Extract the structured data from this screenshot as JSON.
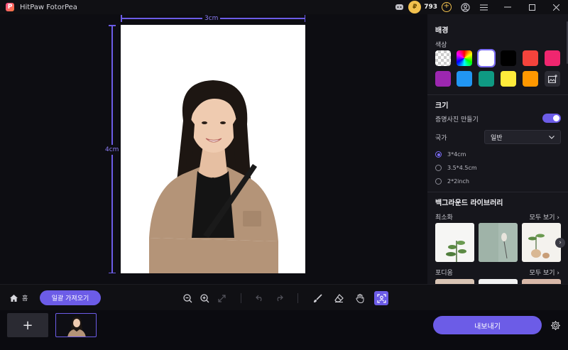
{
  "app": {
    "title": "HitPaw FotorPea",
    "coins": "793"
  },
  "canvas": {
    "width_label": "3cm",
    "height_label": "4cm"
  },
  "panel": {
    "background_title": "배경",
    "color_label": "색상",
    "swatches": [
      {
        "name": "transparent",
        "color": "transparent"
      },
      {
        "name": "rainbow",
        "color": "gradient"
      },
      {
        "name": "white",
        "color": "#ffffff"
      },
      {
        "name": "black",
        "color": "#000000"
      },
      {
        "name": "red",
        "color": "#f4433c"
      },
      {
        "name": "pink",
        "color": "#f0266f"
      },
      {
        "name": "purple",
        "color": "#9c27b0"
      },
      {
        "name": "blue",
        "color": "#2196f3"
      },
      {
        "name": "teal",
        "color": "#0f9a83"
      },
      {
        "name": "yellow",
        "color": "#ffeb3b"
      },
      {
        "name": "orange",
        "color": "#ff9800"
      }
    ],
    "size_title": "크기",
    "id_photo_label": "증명사진 만들기",
    "country_label": "국가",
    "country_value": "일반",
    "sizes": [
      "3*4cm",
      "3.5*4.5cm",
      "2*2inch"
    ],
    "library_title": "백그라운드 라이브러리",
    "minimal_label": "최소화",
    "see_all": "모두 보기",
    "podium_label": "포디움"
  },
  "toolbar": {
    "home_label": "홈",
    "import_label": "일괄 가져오기"
  },
  "bottom": {
    "export_label": "내보내기"
  },
  "colors": {
    "accent": "#6c5ce7"
  }
}
